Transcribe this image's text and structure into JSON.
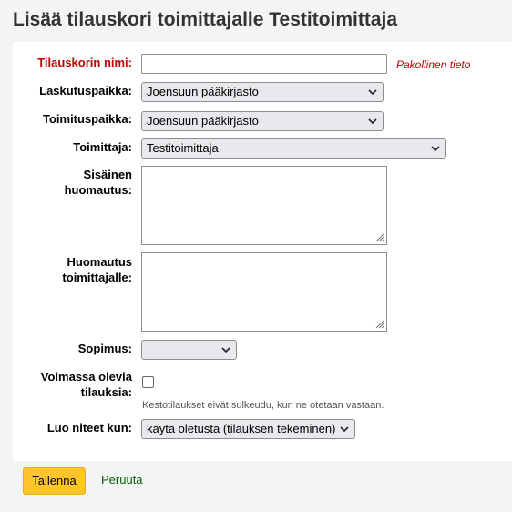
{
  "page": {
    "title": "Lisää tilauskori toimittajalle Testitoimittaja"
  },
  "form": {
    "basket_name": {
      "label": "Tilauskorin nimi:",
      "value": "",
      "required_hint": "Pakollinen tieto"
    },
    "billing_place": {
      "label": "Laskutuspaikka:",
      "selected": "Joensuun pääkirjasto"
    },
    "delivery_place": {
      "label": "Toimituspaikka:",
      "selected": "Joensuun pääkirjasto"
    },
    "vendor": {
      "label": "Toimittaja:",
      "selected": "Testitoimittaja"
    },
    "internal_note": {
      "label_line1": "Sisäinen",
      "label_line2": "huomautus:",
      "value": ""
    },
    "vendor_note": {
      "label_line1": "Huomautus",
      "label_line2": "toimittajalle:",
      "value": ""
    },
    "contract": {
      "label": "Sopimus:",
      "selected": ""
    },
    "standing_orders": {
      "label_line1": "Voimassa olevia",
      "label_line2": "tilauksia:",
      "checked": false,
      "hint": "Kestotilaukset eivät sulkeudu, kun ne otetaan vastaan."
    },
    "create_items": {
      "label": "Luo niteet kun:",
      "selected": "käytä oletusta (tilauksen tekeminen)"
    }
  },
  "actions": {
    "save_label": "Tallenna",
    "cancel_label": "Peruuta"
  },
  "colors": {
    "required": "#c00000",
    "save_button": "#ffc529",
    "cancel_link": "#006100",
    "background": "#f3f4f4"
  }
}
